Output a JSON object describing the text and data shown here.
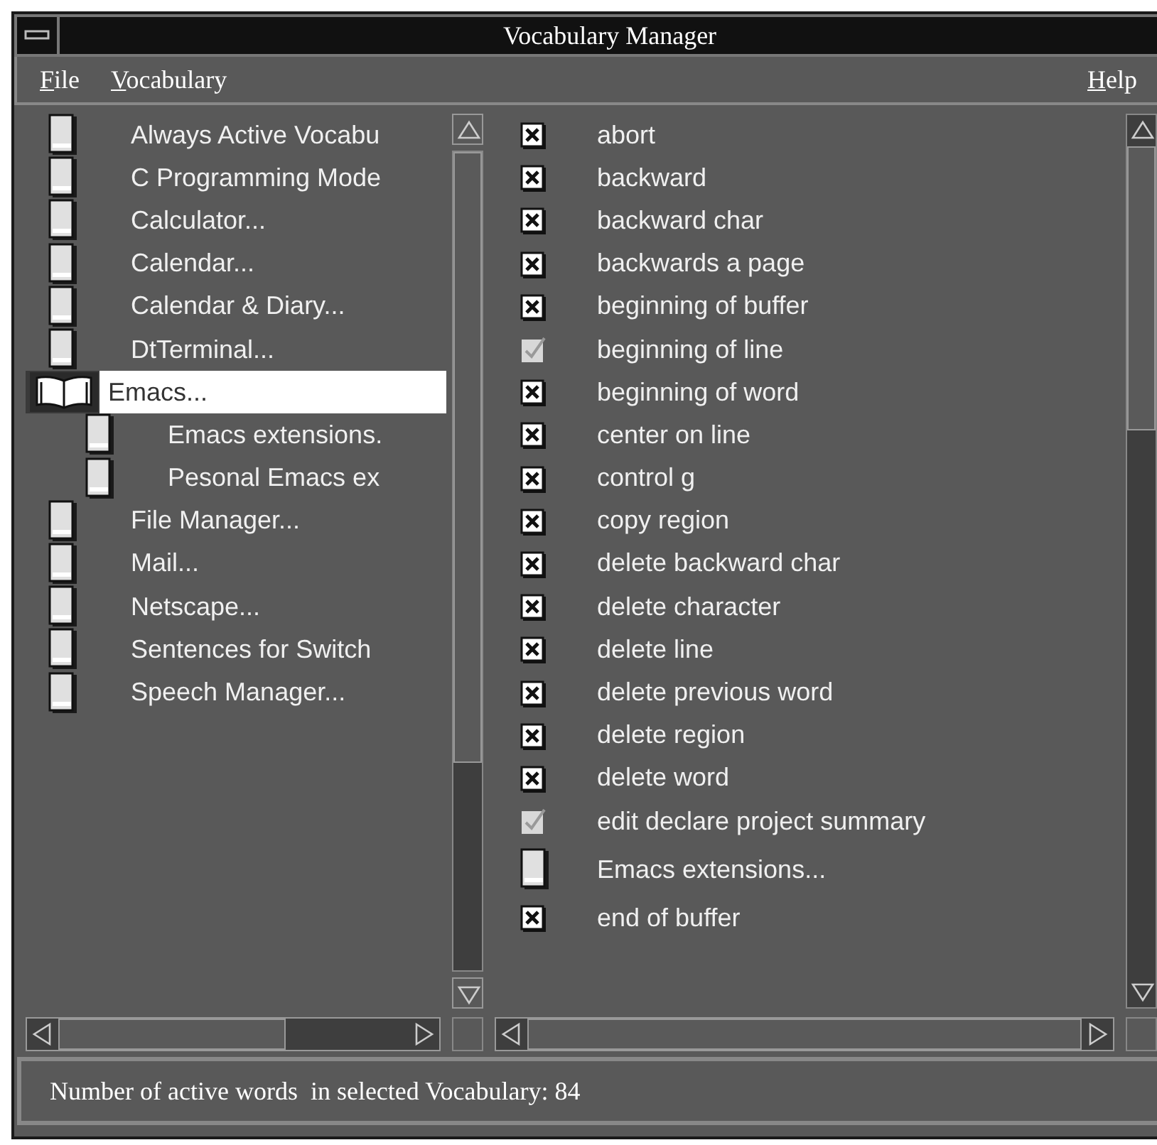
{
  "window": {
    "title": "Vocabulary Manager"
  },
  "menu": [
    {
      "label": "File"
    },
    {
      "label": "Vocabulary"
    },
    {
      "label": "Help"
    }
  ],
  "vocabularies": [
    {
      "label": "Always Active Vocabu",
      "selected": false,
      "expanded": false
    },
    {
      "label": "C Programming Mode",
      "selected": false,
      "expanded": false
    },
    {
      "label": "Calculator...",
      "selected": false,
      "expanded": false
    },
    {
      "label": "Calendar...",
      "selected": false,
      "expanded": false
    },
    {
      "label": "Calendar & Diary...",
      "selected": false,
      "expanded": false
    },
    {
      "label": "DtTerminal...",
      "selected": false,
      "expanded": false
    },
    {
      "label": "Emacs...",
      "selected": true,
      "expanded": true,
      "children": [
        {
          "label": "Emacs extensions.",
          "selected": false,
          "expanded": false
        },
        {
          "label": "Pesonal Emacs ex",
          "selected": false,
          "expanded": false
        }
      ]
    },
    {
      "label": "File Manager...",
      "selected": false,
      "expanded": false
    },
    {
      "label": "Mail...",
      "selected": false,
      "expanded": false
    },
    {
      "label": "Netscape...",
      "selected": false,
      "expanded": false
    },
    {
      "label": "Sentences for Switch",
      "selected": false,
      "expanded": false
    },
    {
      "label": "Speech Manager...",
      "selected": false,
      "expanded": false
    }
  ],
  "words": [
    {
      "kind": "word",
      "label": "abort",
      "disabled": false
    },
    {
      "kind": "word",
      "label": "backward",
      "disabled": false
    },
    {
      "kind": "word",
      "label": "backward char",
      "disabled": false
    },
    {
      "kind": "word",
      "label": "backwards a page",
      "disabled": false
    },
    {
      "kind": "word",
      "label": "beginning of buffer",
      "disabled": false
    },
    {
      "kind": "word",
      "label": "beginning of line",
      "disabled": true
    },
    {
      "kind": "word",
      "label": "beginning of word",
      "disabled": false
    },
    {
      "kind": "word",
      "label": "center on line",
      "disabled": false
    },
    {
      "kind": "word",
      "label": "control g",
      "disabled": false
    },
    {
      "kind": "word",
      "label": "copy region",
      "disabled": false
    },
    {
      "kind": "word",
      "label": "delete backward char",
      "disabled": false
    },
    {
      "kind": "word",
      "label": "delete character",
      "disabled": false
    },
    {
      "kind": "word",
      "label": "delete line",
      "disabled": false
    },
    {
      "kind": "word",
      "label": "delete previous word",
      "disabled": false
    },
    {
      "kind": "word",
      "label": "delete region",
      "disabled": false
    },
    {
      "kind": "word",
      "label": "delete word",
      "disabled": false
    },
    {
      "kind": "word",
      "label": "edit declare project summary",
      "disabled": true
    },
    {
      "kind": "vocabulary",
      "label": "Emacs extensions..."
    },
    {
      "kind": "word",
      "label": "end of buffer",
      "disabled": false
    }
  ],
  "status_bar": "Number of active words  in selected Vocabulary: 84"
}
